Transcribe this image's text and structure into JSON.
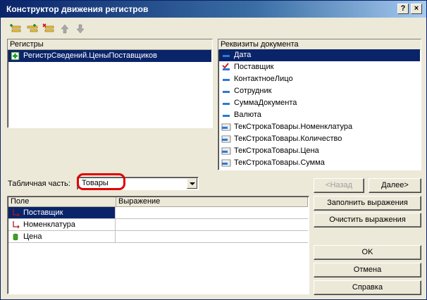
{
  "window": {
    "title": "Конструктор движения регистров",
    "help_button": "?",
    "close_button": "×"
  },
  "toolbar": {
    "icons": [
      "add-icon",
      "add-child-icon",
      "delete-icon",
      "move-up-icon",
      "move-down-icon"
    ]
  },
  "registers": {
    "header": "Регистры",
    "items": [
      {
        "label": "РегистрСведений.ЦеныПоставщиков",
        "icon": "checkbox-plus-icon",
        "selected": true
      }
    ]
  },
  "attributes": {
    "header": "Реквизиты документа",
    "items": [
      {
        "label": "Дата",
        "icon": "attribute-icon",
        "selected": true
      },
      {
        "label": "Поставщик",
        "icon": "attribute-checked-icon",
        "selected": false
      },
      {
        "label": "КонтактноеЛицо",
        "icon": "attribute-icon",
        "selected": false
      },
      {
        "label": "Сотрудник",
        "icon": "attribute-icon",
        "selected": false
      },
      {
        "label": "СуммаДокумента",
        "icon": "attribute-icon",
        "selected": false
      },
      {
        "label": "Валюта",
        "icon": "attribute-icon",
        "selected": false
      },
      {
        "label": "ТекСтрокаТовары.Номенклатура",
        "icon": "table-attribute-icon",
        "selected": false
      },
      {
        "label": "ТекСтрокаТовары.Количество",
        "icon": "table-attribute-icon",
        "selected": false
      },
      {
        "label": "ТекСтрокаТовары.Цена",
        "icon": "table-attribute-icon",
        "selected": false
      },
      {
        "label": "ТекСтрокаТовары.Сумма",
        "icon": "table-attribute-icon",
        "selected": false
      }
    ]
  },
  "tabular_section": {
    "label": "Табличная часть:",
    "value": "Товары"
  },
  "fields_grid": {
    "columns": [
      "Поле",
      "Выражение"
    ],
    "rows": [
      {
        "field": "Поставщик",
        "expression": "",
        "icon": "dimension-icon",
        "selected": true
      },
      {
        "field": "Номенклатура",
        "expression": "",
        "icon": "dimension-icon",
        "selected": false
      },
      {
        "field": "Цена",
        "expression": "",
        "icon": "resource-icon",
        "selected": false
      }
    ]
  },
  "buttons": {
    "back": "<Назад",
    "next": "Далее>",
    "fill": "Заполнить выражения",
    "clear": "Очистить выражения",
    "ok": "OK",
    "cancel": "Отмена",
    "help": "Справка"
  },
  "colors": {
    "selection": "#0a246a",
    "highlight_oval": "#e00000",
    "window_face": "#ece9d8"
  }
}
